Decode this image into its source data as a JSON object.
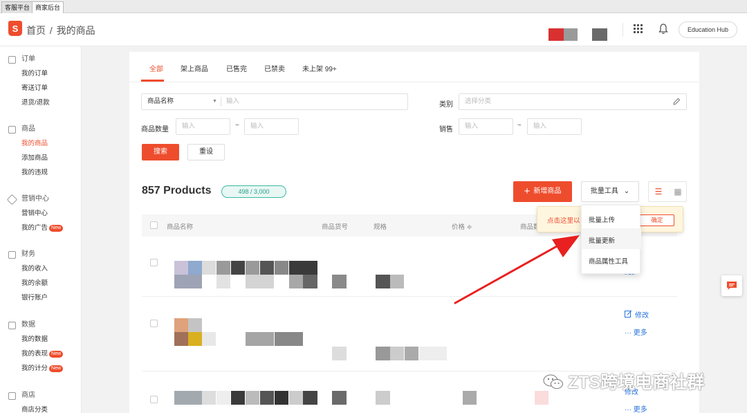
{
  "window_tabs": [
    "客服平台",
    "商家后台"
  ],
  "header": {
    "breadcrumb_home": "首页",
    "breadcrumb_sep": "/",
    "breadcrumb_current": "我的商品",
    "logo_letter": "S",
    "education_hub": "Education Hub"
  },
  "sidebar": {
    "groups": [
      {
        "title": "订单",
        "icon": "clipboard-icon",
        "items": [
          "我的订单",
          "寄送订单",
          "退货/退款"
        ]
      },
      {
        "title": "商品",
        "icon": "box-icon",
        "items": [
          "我的商品",
          "添加商品",
          "我的违规"
        ]
      },
      {
        "title": "营销中心",
        "icon": "tag-icon",
        "items": [
          "营销中心",
          "我的广告"
        ]
      },
      {
        "title": "财务",
        "icon": "wallet-icon",
        "items": [
          "我的收入",
          "我的余额",
          "银行账户"
        ]
      },
      {
        "title": "数据",
        "icon": "chart-icon",
        "items": [
          "我的数据",
          "我的表现",
          "我的计分"
        ]
      },
      {
        "title": "商店",
        "icon": "shop-icon",
        "items": [
          "商店分类"
        ]
      }
    ],
    "new_badge": "New"
  },
  "tabs": [
    "全部",
    "架上商品",
    "已售完",
    "已禁卖",
    "未上架 99+"
  ],
  "filters": {
    "name_select": "商品名称",
    "name_placeholder": "输入",
    "category_label": "类别",
    "category_placeholder": "选择分类",
    "qty_label": "商品数量",
    "qty_min_placeholder": "输入",
    "qty_max_placeholder": "输入",
    "sales_label": "销售",
    "sales_min_placeholder": "输入",
    "sales_max_placeholder": "输入",
    "range_sep": "~",
    "search_button": "搜索",
    "reset_button": "重设"
  },
  "summary": {
    "product_count": "857 Products",
    "quota": "498 / 3,000",
    "add_button": "新增商品",
    "bulk_tools": "批量工具"
  },
  "table": {
    "headers": [
      "商品名称",
      "商品货号",
      "规格",
      "价格 ≑",
      "商品数"
    ],
    "edit": "修改",
    "more": "更多"
  },
  "dropdown": [
    "批量上传",
    "批量更新",
    "商品属性工具"
  ],
  "tooltip": {
    "text": "点击这里以",
    "confirm": "确定"
  },
  "watermark": "ZTS跨境电商社群",
  "colors": {
    "accent": "#ee4d2d",
    "link": "#2673dd",
    "quota": "#3bb9a6"
  }
}
